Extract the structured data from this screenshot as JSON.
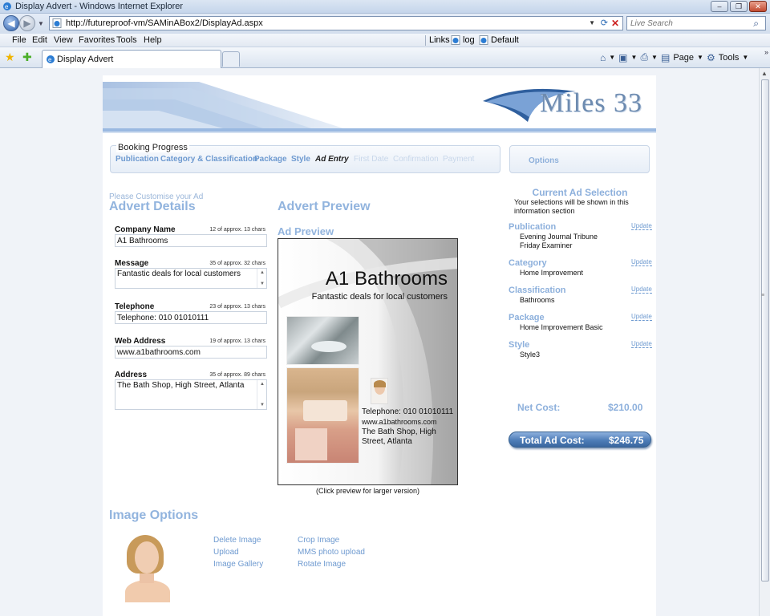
{
  "window": {
    "title": "Display Advert - Windows Internet Explorer"
  },
  "address": {
    "url": "http://futureproof-vm/SAMinABox2/DisplayAd.aspx",
    "search_placeholder": "Live Search"
  },
  "menu": {
    "items": [
      "File",
      "Edit",
      "View",
      "Favorites",
      "Tools",
      "Help"
    ],
    "links_label": "Links",
    "links": [
      "log",
      "Default"
    ]
  },
  "tab": {
    "title": "Display Advert"
  },
  "commands": {
    "page": "Page",
    "tools": "Tools"
  },
  "logo": {
    "text": "Miles 33"
  },
  "booking": {
    "legend": "Booking Progress",
    "steps": [
      "Publication",
      "Category & Classification",
      "Package",
      "Style",
      "Ad Entry",
      "First Date",
      "Confirmation",
      "Payment"
    ],
    "options_label": "Options"
  },
  "details": {
    "customise": "Please Customise your Ad",
    "title": "Advert Details",
    "fields": [
      {
        "label": "Company Name",
        "count": "12 of approx. 13 chars",
        "value": "A1 Bathrooms"
      },
      {
        "label": "Message",
        "count": "35 of approx. 32 chars",
        "value": "Fantastic deals for local customers"
      },
      {
        "label": "Telephone",
        "count": "23 of approx. 13 chars",
        "value": "Telephone: 010 01010111"
      },
      {
        "label": "Web Address",
        "count": "19 of approx. 13 chars",
        "value": "www.a1bathrooms.com"
      },
      {
        "label": "Address",
        "count": "35 of approx. 89 chars",
        "value": "The Bath Shop, High Street, Atlanta"
      }
    ]
  },
  "preview": {
    "title": "Advert Preview",
    "subtitle": "Ad Preview",
    "ad_title": "A1 Bathrooms",
    "ad_tagline": "Fantastic deals for local customers",
    "ad_phone": "Telephone: 010 01010111",
    "ad_web": "www.a1bathrooms.com",
    "ad_address_1": "The Bath Shop, High",
    "ad_address_2": "Street, Atlanta",
    "caption": "(Click preview for larger version)"
  },
  "selection": {
    "title": "Current Ad Selection",
    "desc_1": "Your selections will be shown in this",
    "desc_2": "information section",
    "update_label": "Update",
    "publication": {
      "label": "Publication",
      "values": [
        "Evening Journal Tribune",
        "Friday Examiner"
      ]
    },
    "category": {
      "label": "Category",
      "value": "Home Improvement"
    },
    "classification": {
      "label": "Classification",
      "value": "Bathrooms"
    },
    "package": {
      "label": "Package",
      "value": "Home Improvement Basic"
    },
    "style": {
      "label": "Style",
      "value": "Style3"
    },
    "net_label": "Net Cost:",
    "net_value": "$210.00",
    "total_label": "Total Ad Cost:",
    "total_value": "$246.75"
  },
  "image_options": {
    "title": "Image Options",
    "links": [
      "Delete Image",
      "Upload",
      "Image Gallery",
      "Crop Image",
      "MMS photo upload",
      "Rotate Image"
    ]
  },
  "colors": {
    "accent": "#92b4de",
    "link": "#6e9ad0",
    "total_bar": "#4e7db8"
  },
  "icons": [
    "ie-icon",
    "back-icon",
    "forward-icon",
    "refresh-icon",
    "stop-icon",
    "search-icon",
    "favorites-star-icon",
    "add-favorites-icon",
    "home-icon",
    "feeds-icon",
    "print-icon",
    "page-icon",
    "tools-gear-icon"
  ]
}
